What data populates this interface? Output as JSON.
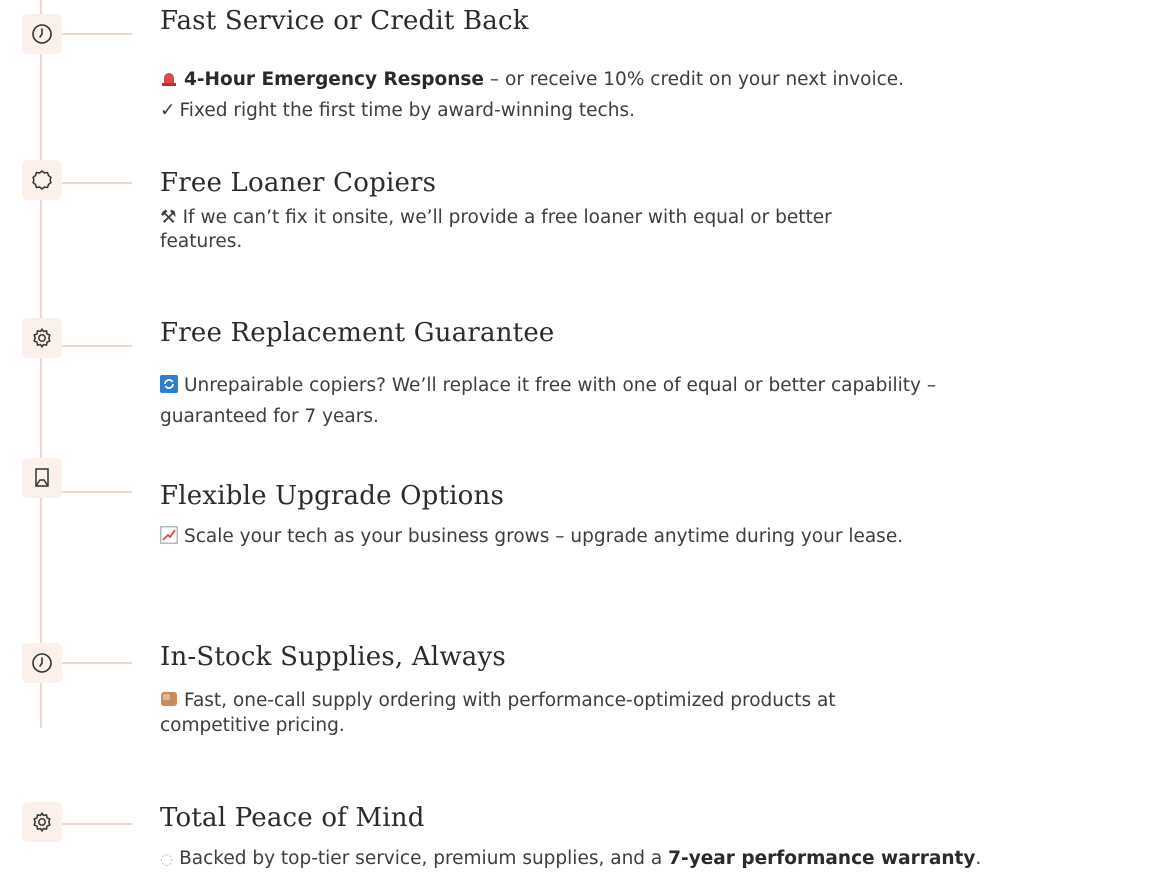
{
  "sections": [
    {
      "icon": "clock-icon",
      "title": "Fast Service or Credit Back",
      "lines": [
        {
          "emoji": "siren-icon",
          "bold": "4-Hour Emergency Response",
          "text": " – or receive 10% credit on your next invoice."
        },
        {
          "emoji": "checkmark-icon",
          "text": "Fixed right the first time by award-winning techs."
        }
      ]
    },
    {
      "icon": "badge-icon",
      "title": "Free Loaner Copiers",
      "lines": [
        {
          "emoji": "tools-icon",
          "text": "If we can’t fix it onsite, we’ll provide a free loaner with equal or better",
          "text2": "features."
        }
      ]
    },
    {
      "icon": "gear-icon",
      "title": "Free Replacement Guarantee",
      "lines": [
        {
          "emoji": "refresh-icon",
          "text": "Unrepairable copiers? We’ll replace it free with one of equal or better capability –",
          "text2": "guaranteed for 7 years."
        }
      ]
    },
    {
      "icon": "copier-icon",
      "title": "Flexible Upgrade Options",
      "lines": [
        {
          "emoji": "chart-icon",
          "text": "Scale your tech as your business grows – upgrade anytime during your lease."
        }
      ]
    },
    {
      "icon": "clock-icon",
      "title": "In-Stock Supplies, Always",
      "lines": [
        {
          "emoji": "box-icon",
          "text": "Fast, one-call supply ordering with performance-optimized products at",
          "text2": "competitive pricing."
        }
      ]
    },
    {
      "icon": "gear-icon",
      "title": "Total Peace of Mind",
      "lines": [
        {
          "emoji": "shield-icon",
          "text": "Backed by top-tier service, premium supplies, and a ",
          "bold": "7-year performance warranty",
          "tail": "."
        }
      ]
    }
  ]
}
